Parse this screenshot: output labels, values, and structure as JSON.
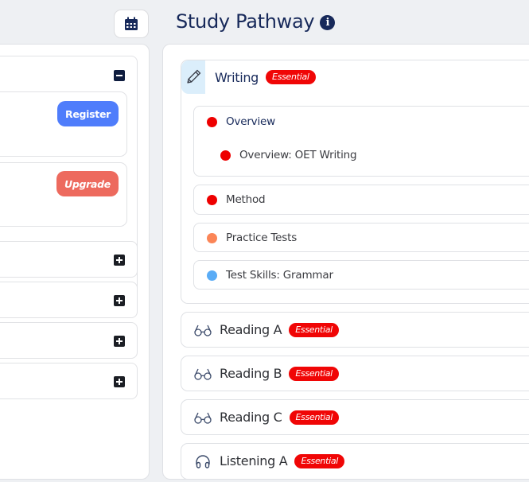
{
  "header": {
    "calendar_icon": "calendar-icon",
    "title": "Study Pathway",
    "info_icon": "info-icon",
    "info_glyph": "i"
  },
  "left_panel": {
    "expanded_group": {
      "toggle": "minus",
      "cards": [
        {
          "button_label": "Register",
          "button_color": "#4f7dfb"
        },
        {
          "button_label": "Upgrade",
          "button_color": "#ed6a5e"
        }
      ]
    },
    "collapsed_groups": [
      {
        "toggle": "plus"
      },
      {
        "toggle": "plus"
      },
      {
        "toggle": "plus"
      },
      {
        "toggle": "plus"
      }
    ]
  },
  "pathway": {
    "badge_label": "Essential",
    "badge_color": "#f00606",
    "sections": [
      {
        "title": "Writing",
        "icon": "pencil-icon",
        "essential": true,
        "expanded": true,
        "items": [
          {
            "label": "Overview",
            "dot_color": "#ee0000",
            "children": [
              {
                "label": "Overview: OET Writing",
                "dot_color": "#ee0000"
              }
            ]
          },
          {
            "label": "Method",
            "dot_color": "#ee0000"
          },
          {
            "label": "Practice Tests",
            "dot_color": "#fb8557"
          },
          {
            "label": "Test Skills: Grammar",
            "dot_color": "#5aacf6"
          }
        ]
      },
      {
        "title": "Reading A",
        "icon": "glasses-icon",
        "essential": true
      },
      {
        "title": "Reading B",
        "icon": "glasses-icon",
        "essential": true
      },
      {
        "title": "Reading C",
        "icon": "glasses-icon",
        "essential": true
      },
      {
        "title": "Listening A",
        "icon": "headphones-icon",
        "essential": true
      }
    ]
  }
}
